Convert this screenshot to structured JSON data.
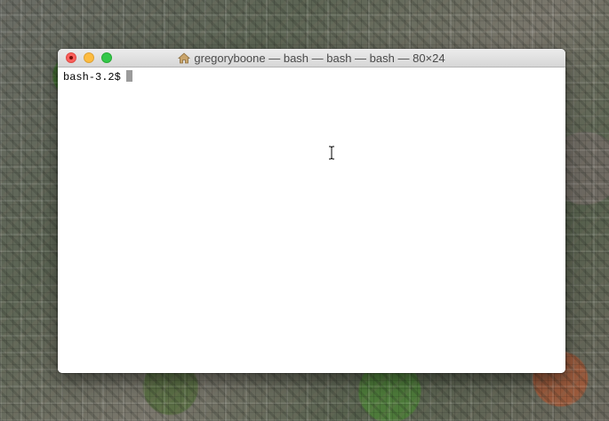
{
  "window": {
    "title": "gregoryboone — bash — bash — bash — 80×24",
    "title_icon": "home-folder-icon"
  },
  "terminal": {
    "prompt": "bash-3.2$",
    "input": ""
  },
  "colors": {
    "close": "#fc605c",
    "minimize": "#fdbc40",
    "zoom": "#34c84a",
    "terminal_bg": "#ffffff",
    "terminal_fg": "#000000",
    "cursor": "#9b9b9b"
  },
  "pointer": "i-beam-cursor-icon"
}
